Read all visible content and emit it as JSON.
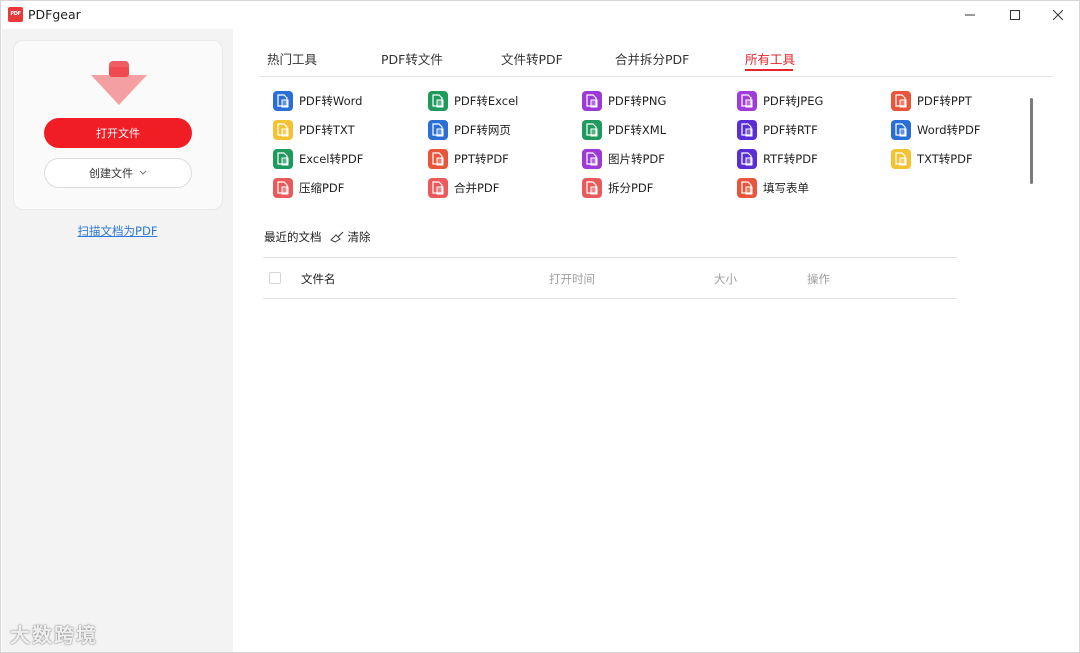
{
  "window": {
    "logo_text": "PDF",
    "title": "PDFgear"
  },
  "sidebar": {
    "open_label": "打开文件",
    "create_label": "创建文件",
    "scan_label": "扫描文档为PDF",
    "watermark": "大数跨境"
  },
  "tabs": [
    {
      "label": "热门工具"
    },
    {
      "label": "PDF转文件"
    },
    {
      "label": "文件转PDF"
    },
    {
      "label": "合并拆分PDF"
    },
    {
      "label": "所有工具"
    }
  ],
  "active_tab": "所有工具",
  "tools": [
    {
      "label": "PDF转Word",
      "icon": "pdf-to-word-icon",
      "color": "#2b6fd6"
    },
    {
      "label": "PDF转Excel",
      "icon": "pdf-to-excel-icon",
      "color": "#1e9a5c"
    },
    {
      "label": "PDF转PNG",
      "icon": "pdf-to-png-icon",
      "color": "#9b3ad6"
    },
    {
      "label": "PDF转JPEG",
      "icon": "pdf-to-jpeg-icon",
      "color": "#a23cd8"
    },
    {
      "label": "PDF转PPT",
      "icon": "pdf-to-ppt-icon",
      "color": "#e8553a"
    },
    {
      "label": "PDF转TXT",
      "icon": "pdf-to-txt-icon",
      "color": "#f2c232"
    },
    {
      "label": "PDF转网页",
      "icon": "pdf-to-webpage-icon",
      "color": "#2b6fd6"
    },
    {
      "label": "PDF转XML",
      "icon": "pdf-to-xml-icon",
      "color": "#1e9a5c"
    },
    {
      "label": "PDF转RTF",
      "icon": "pdf-to-rtf-icon",
      "color": "#5a2ed6"
    },
    {
      "label": "Word转PDF",
      "icon": "word-to-pdf-icon",
      "color": "#2b6fd6"
    },
    {
      "label": "Excel转PDF",
      "icon": "excel-to-pdf-icon",
      "color": "#1e9a5c"
    },
    {
      "label": "PPT转PDF",
      "icon": "ppt-to-pdf-icon",
      "color": "#e8553a"
    },
    {
      "label": "图片转PDF",
      "icon": "image-to-pdf-icon",
      "color": "#9b3ad6"
    },
    {
      "label": "RTF转PDF",
      "icon": "rtf-to-pdf-icon",
      "color": "#5a2ed6"
    },
    {
      "label": "TXT转PDF",
      "icon": "txt-to-pdf-icon",
      "color": "#f2c232"
    },
    {
      "label": "压缩PDF",
      "icon": "compress-pdf-icon",
      "color": "#ea5a5a"
    },
    {
      "label": "合并PDF",
      "icon": "merge-pdf-icon",
      "color": "#ea5a5a"
    },
    {
      "label": "拆分PDF",
      "icon": "split-pdf-icon",
      "color": "#ea5a5a"
    },
    {
      "label": "填写表单",
      "icon": "fill-form-icon",
      "color": "#e8553a"
    }
  ],
  "recent": {
    "title": "最近的文档",
    "clear_label": "清除",
    "columns": [
      "文件名",
      "打开时间",
      "大小",
      "操作"
    ]
  },
  "colors": {
    "accent": "#e5252b",
    "primary_button": "#f01e24",
    "link": "#2f7ad6",
    "sidebar_bg": "#f3f3f3"
  }
}
